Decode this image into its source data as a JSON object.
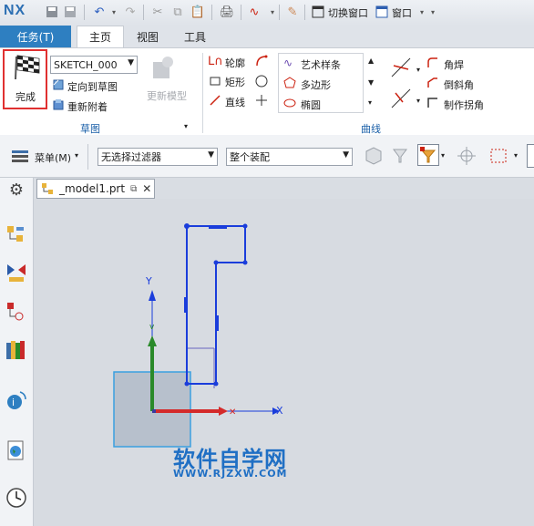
{
  "app": {
    "logo": "NX"
  },
  "quick_access": {
    "switch_window": "切换窗口",
    "window": "窗口"
  },
  "tabs": {
    "task": "任务(T)",
    "home": "主页",
    "view": "视图",
    "tools": "工具"
  },
  "sketch_group": {
    "finish": "完成",
    "sketch_name": "SKETCH_000",
    "orient": "定向到草图",
    "reattach": "重新附着",
    "update_model": "更新模型",
    "label": "草图"
  },
  "curve_group": {
    "profile": "轮廓",
    "rectangle": "矩形",
    "line": "直线",
    "studio_spline": "艺术样条",
    "polygon": "多边形",
    "ellipse": "椭圆",
    "fillet": "角焊",
    "chamfer": "倒斜角",
    "make_corner": "制作拐角",
    "label": "曲线"
  },
  "toolbar": {
    "menu": "菜单(M)",
    "filter": "无选择过滤器",
    "assembly": "整个装配"
  },
  "document": {
    "tab_label": "_model1.prt"
  },
  "axes": {
    "x": "X",
    "y": "Y"
  },
  "watermark": {
    "title": "软件自学网",
    "url": "WWW.RJZXW.COM"
  },
  "colors": {
    "accent": "#2e7fc1",
    "sketch": "#1a3ddb",
    "x_axis": "#d42a2a",
    "y_axis": "#2a8a2a"
  }
}
